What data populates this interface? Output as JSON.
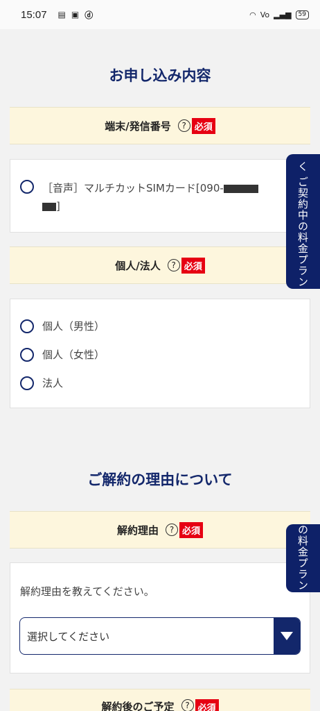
{
  "status": {
    "time": "15:07",
    "icons": [
      "message-icon",
      "app-icon",
      "docomo-icon"
    ],
    "battery": "59"
  },
  "section1": {
    "title": "お申し込み内容"
  },
  "terminal": {
    "label": "端末/発信番号",
    "help": "?",
    "required": "必須",
    "option": {
      "prefix": "［音声］マルチカットSIMカード[090-",
      "suffix": "]"
    }
  },
  "person": {
    "label": "個人/法人",
    "help": "?",
    "required": "必須",
    "options": [
      "個人（男性）",
      "個人（女性）",
      "法人"
    ]
  },
  "section2": {
    "title": "ご解約の理由について"
  },
  "reason": {
    "label": "解約理由",
    "help": "?",
    "required": "必須",
    "prompt": "解約理由を教えてください。",
    "select_value": "選択してください"
  },
  "after": {
    "label": "解約後のご予定",
    "help": "?",
    "required": "必須"
  },
  "side_tab": {
    "label": "く ご契約中の料金プラン",
    "label2": "の料金プラン"
  }
}
